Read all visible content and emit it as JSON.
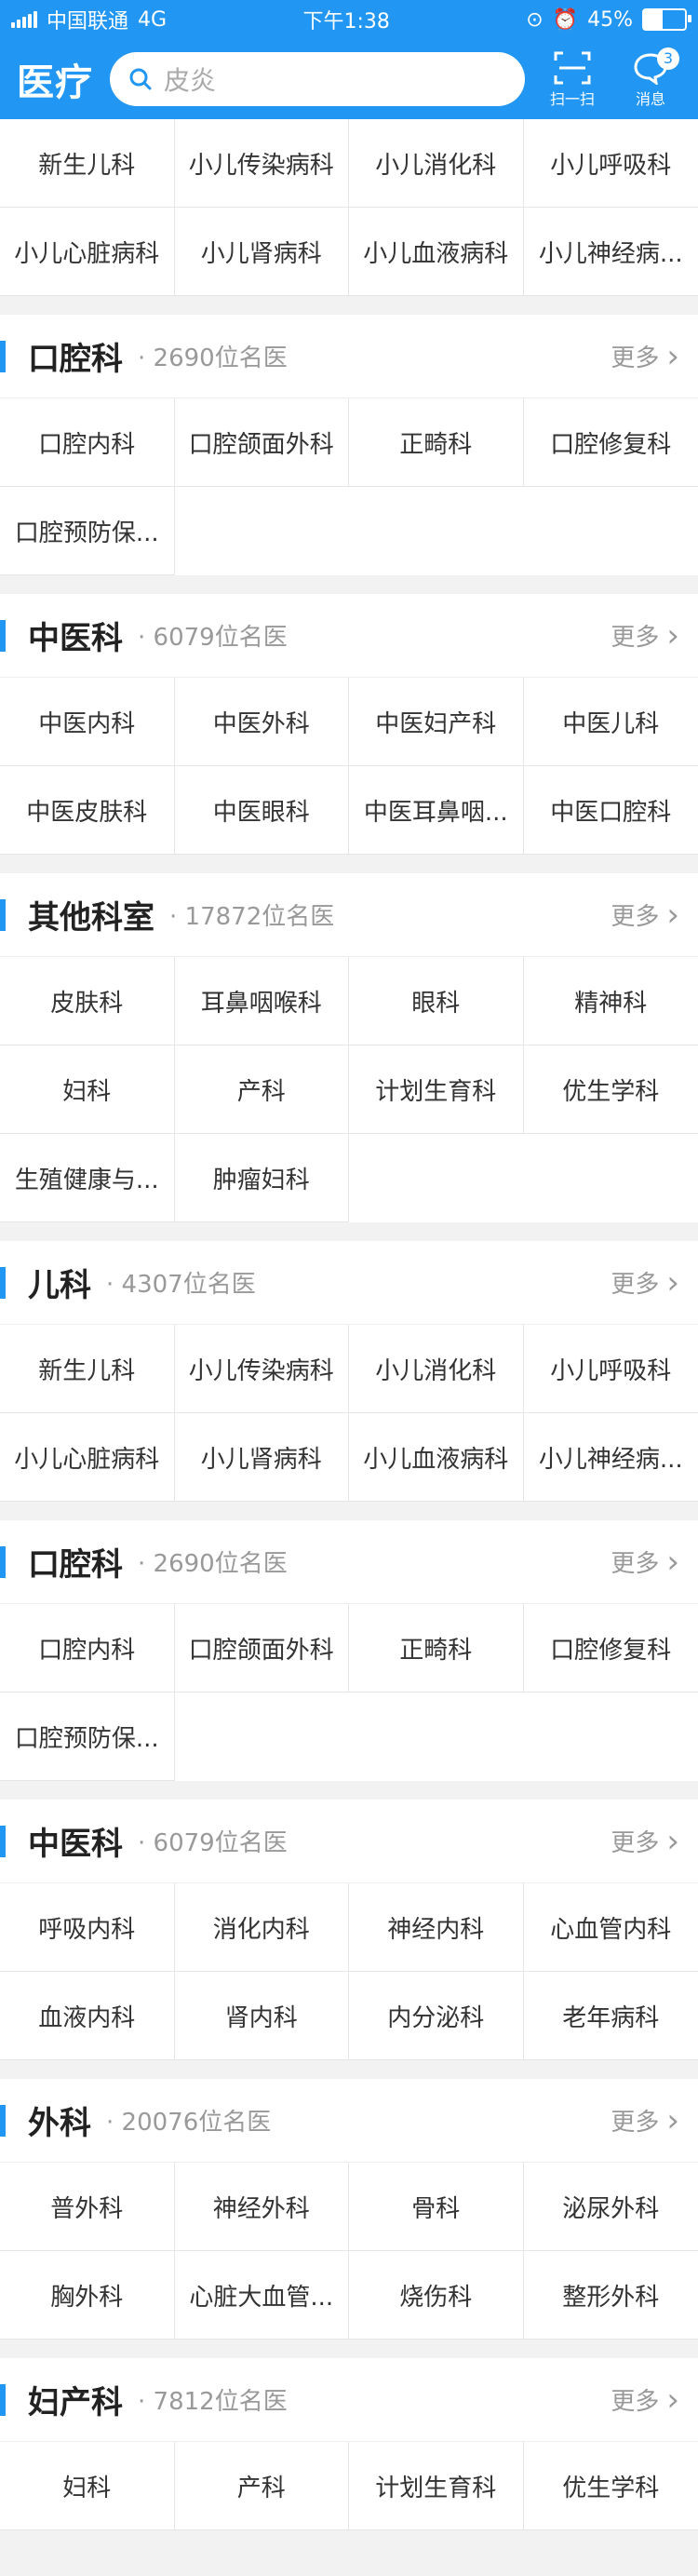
{
  "status_bar": {
    "carrier": "中国联通",
    "network": "4G",
    "time": "下午1:38",
    "battery": "45%"
  },
  "header": {
    "logo": "医疗",
    "search_placeholder": "皮炎",
    "scan_label": "扫一扫",
    "message_label": "消息",
    "message_badge": "3"
  },
  "top_grid": [
    "新生儿科",
    "小儿传染病科",
    "小儿消化科",
    "小儿呼吸科",
    "小儿心脏病科",
    "小儿肾病科",
    "小儿血液病科",
    "小儿神经病..."
  ],
  "sections": [
    {
      "title": "口腔科",
      "count": "· 2690位名医",
      "more": "更多",
      "items": [
        "口腔内科",
        "口腔颌面外科",
        "正畸科",
        "口腔修复科",
        "口腔预防保..."
      ]
    },
    {
      "title": "中医科",
      "count": "· 6079位名医",
      "more": "更多",
      "items": [
        "中医内科",
        "中医外科",
        "中医妇产科",
        "中医儿科",
        "中医皮肤科",
        "中医眼科",
        "中医耳鼻咽...",
        "中医口腔科"
      ]
    },
    {
      "title": "其他科室",
      "count": "· 17872位名医",
      "more": "更多",
      "items": [
        "皮肤科",
        "耳鼻咽喉科",
        "眼科",
        "精神科",
        "妇科",
        "产科",
        "计划生育科",
        "优生学科",
        "生殖健康与...",
        "肿瘤妇科"
      ]
    },
    {
      "title": "儿科",
      "count": "· 4307位名医",
      "more": "更多",
      "items": [
        "新生儿科",
        "小儿传染病科",
        "小儿消化科",
        "小儿呼吸科",
        "小儿心脏病科",
        "小儿肾病科",
        "小儿血液病科",
        "小儿神经病..."
      ]
    },
    {
      "title": "口腔科",
      "count": "· 2690位名医",
      "more": "更多",
      "items": [
        "口腔内科",
        "口腔颌面外科",
        "正畸科",
        "口腔修复科",
        "口腔预防保..."
      ]
    },
    {
      "title": "中医科",
      "count": "· 6079位名医",
      "more": "更多",
      "items": [
        "呼吸内科",
        "消化内科",
        "神经内科",
        "心血管内科",
        "血液内科",
        "肾内科",
        "内分泌科",
        "老年病科"
      ]
    },
    {
      "title": "外科",
      "count": "· 20076位名医",
      "more": "更多",
      "items": [
        "普外科",
        "神经外科",
        "骨科",
        "泌尿外科",
        "胸外科",
        "心脏大血管...",
        "烧伤科",
        "整形外科"
      ]
    },
    {
      "title": "妇产科",
      "count": "· 7812位名医",
      "more": "更多",
      "items": [
        "妇科",
        "产科",
        "计划生育科",
        "优生学科"
      ]
    }
  ]
}
